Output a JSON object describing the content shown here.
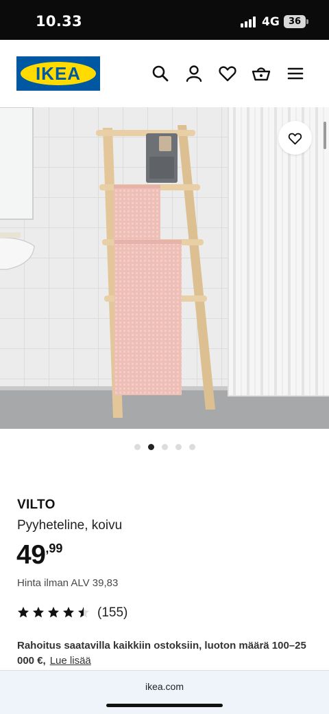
{
  "status_bar": {
    "time": "10.33",
    "network": "4G",
    "battery": "36"
  },
  "header": {
    "logo_text": "IKEA",
    "icons": [
      "search-icon",
      "user-icon",
      "heart-icon",
      "basket-icon",
      "menu-icon"
    ]
  },
  "gallery": {
    "total_images": 5,
    "active_index": 1
  },
  "product": {
    "brand": "VILTO",
    "description": "Pyyheteline, koivu",
    "price_integer": "49",
    "price_decimal": ",99",
    "vat_text": "Hinta ilman ALV 39,83",
    "rating": 4.5,
    "rating_max": 5,
    "reviews": "(155)",
    "finance_text": "Rahoitus saatavilla kaikkiin ostoksiin, luoton määrä 100–25 000 €,",
    "finance_link": "Lue lisää"
  },
  "browser": {
    "url": "ikea.com"
  },
  "colors": {
    "ikea_blue": "#0058a3",
    "ikea_yellow": "#ffdb00",
    "towel_pink": "#efc3bc",
    "birch": "#e3c79b"
  }
}
